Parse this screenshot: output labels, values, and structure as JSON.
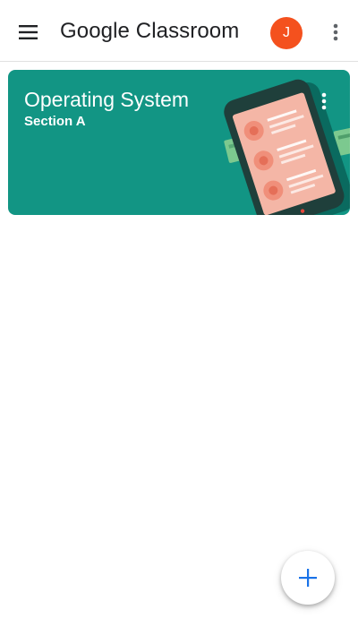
{
  "app_bar": {
    "title": "Google Classroom",
    "menu_icon": "hamburger-menu-icon",
    "more_icon": "more-vert-icon",
    "avatar": {
      "initial": "J",
      "color": "#f4511e"
    }
  },
  "classes": [
    {
      "name": "Operating System",
      "section": "Section A",
      "theme_color": "#129584",
      "illustration": "phone-contacts-illustration",
      "more_icon": "more-vert-icon"
    }
  ],
  "fab": {
    "icon": "plus-icon",
    "icon_color": "#1a73e8"
  }
}
